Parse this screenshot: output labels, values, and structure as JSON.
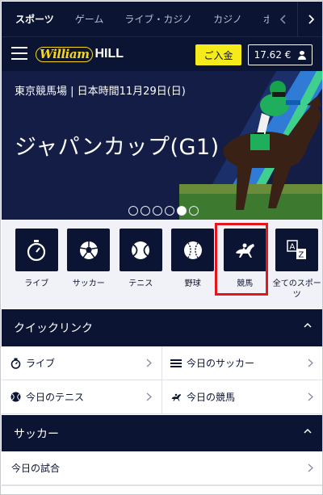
{
  "top_tabs": [
    "スポーツ",
    "ゲーム",
    "ライブ・カジノ",
    "カジノ",
    "ポー"
  ],
  "header": {
    "logo_script": "William",
    "logo_word": "HILL",
    "deposit_label": "ご入金",
    "balance": "17.62 €"
  },
  "banner": {
    "venue": "東京競馬場 | 日本時間11月29日(日)",
    "title": "ジャパンカップ(G1)",
    "dots_total": 6,
    "dots_active_index": 4
  },
  "sports": [
    {
      "label": "ライブ",
      "icon": "stopwatch-icon"
    },
    {
      "label": "サッカー",
      "icon": "soccer-ball-icon"
    },
    {
      "label": "テニス",
      "icon": "tennis-ball-icon"
    },
    {
      "label": "野球",
      "icon": "baseball-icon"
    },
    {
      "label": "競馬",
      "icon": "horse-racing-icon"
    },
    {
      "label": "全てのスポーツ",
      "icon": "a-z-icon"
    }
  ],
  "quicklinks": {
    "title": "クイックリンク",
    "items": [
      {
        "label": "ライブ",
        "icon": "stopwatch-icon"
      },
      {
        "label": "今日のサッカー",
        "icon": "list-icon"
      },
      {
        "label": "今日のテニス",
        "icon": "tennis-ball-icon"
      },
      {
        "label": "今日の競馬",
        "icon": "horse-racing-icon"
      }
    ]
  },
  "soccer": {
    "title": "サッカー",
    "items": [
      {
        "label": "今日の試合"
      }
    ]
  },
  "colors": {
    "navy": "#0b1433",
    "yellow": "#f5ea1a",
    "highlight_red": "#e3161b",
    "light_bg": "#f1f2f7"
  }
}
